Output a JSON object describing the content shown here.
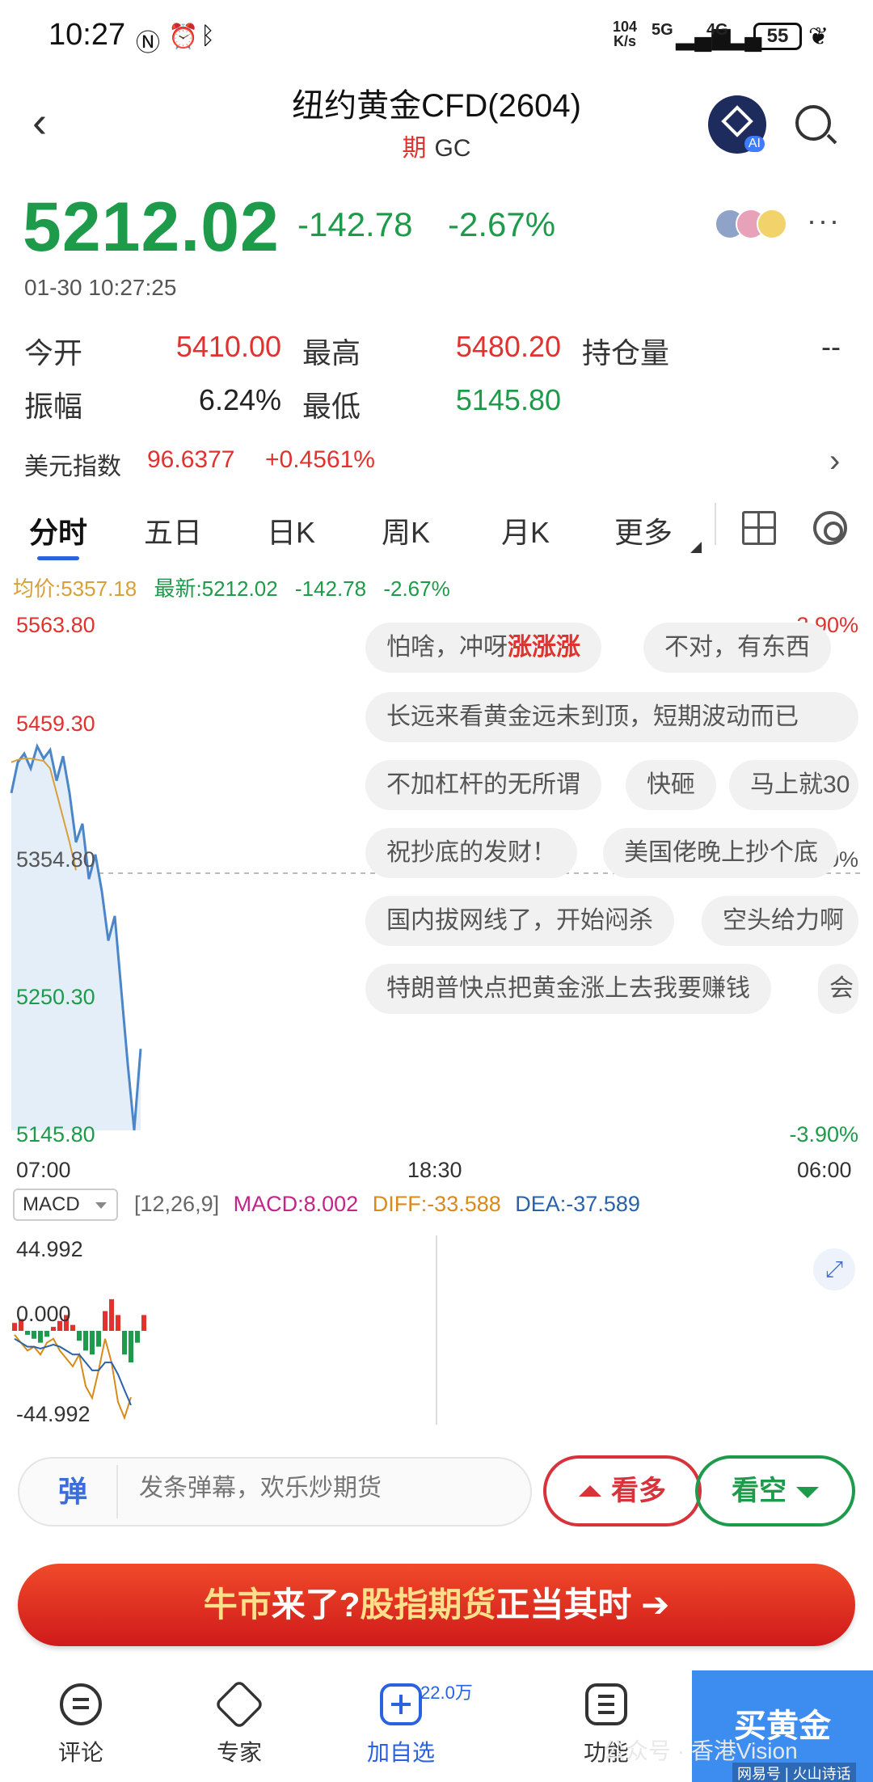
{
  "status_bar": {
    "time": "10:27",
    "net_speed": "104",
    "net_unit": "K/s",
    "sim1": "5G",
    "sim2": "4G",
    "battery": "55"
  },
  "header": {
    "title": "纽约黄金CFD(2604)",
    "tag": "期",
    "code": "GC"
  },
  "quote": {
    "price": "5212.02",
    "change": "-142.78",
    "change_pct": "-2.67%",
    "timestamp": "01-30 10:27:25"
  },
  "stats": {
    "open_label": "今开",
    "open": "5410.00",
    "high_label": "最高",
    "high": "5480.20",
    "oi_label": "持仓量",
    "oi": "--",
    "amp_label": "振幅",
    "amp": "6.24%",
    "low_label": "最低",
    "low": "5145.80"
  },
  "usd_index": {
    "label": "美元指数",
    "value": "96.6377",
    "change": "+0.4561%"
  },
  "tabs": [
    "分时",
    "五日",
    "日K",
    "周K",
    "月K",
    "更多"
  ],
  "legend": {
    "avg": "均价:5357.18",
    "latest": "最新:5212.02",
    "change": "-142.78",
    "pct": "-2.67%"
  },
  "danmaku": [
    {
      "text": "怕啥，冲呀",
      "hl": "涨涨涨"
    },
    {
      "text": "不对，有东西"
    },
    {
      "text": "长远来看黄金远未到顶，短期波动而已"
    },
    {
      "text": "不加杠杆的无所谓"
    },
    {
      "text": "快砸"
    },
    {
      "text": "马上就30"
    },
    {
      "text": "祝抄底的发财！"
    },
    {
      "text": "美国佬晚上抄个底"
    },
    {
      "text": "国内拔网线了，开始闷杀"
    },
    {
      "text": "空头给力啊"
    },
    {
      "text": "特朗普快点把黄金涨上去我要赚钱"
    },
    {
      "text": "会"
    }
  ],
  "chart_data": [
    {
      "type": "line",
      "y_ticks_left": [
        "5563.80",
        "5459.30",
        "5354.80",
        "5250.30",
        "5145.80"
      ],
      "y_ticks_right": [
        "3.90%",
        "0.00%",
        "-3.90%"
      ],
      "x_ticks": [
        "07:00",
        "18:30",
        "06:00"
      ],
      "ylim": [
        5145.8,
        5563.8
      ],
      "series": [
        {
          "values": [
            5420,
            5445,
            5452,
            5440,
            5458,
            5448,
            5455,
            5430,
            5450,
            5420,
            5380,
            5395,
            5350,
            5370,
            5340,
            5300,
            5320,
            5260,
            5200,
            5145.8,
            5212.02
          ],
          "color": "#4a86c8"
        },
        {
          "values": [
            5445,
            5447,
            5448,
            5448,
            5447,
            5446,
            5440,
            5420,
            5400,
            5380,
            5357.18
          ],
          "color": "#d8a03a"
        }
      ]
    },
    {
      "type": "bar",
      "title": "MACD",
      "params": "[12,26,9]",
      "macd": "MACD:8.002",
      "diff": "DIFF:-33.588",
      "dea": "DEA:-37.589",
      "y_ticks": [
        "44.992",
        "0.000",
        "-44.992"
      ],
      "ylim": [
        -44.992,
        44.992
      ],
      "values": [
        4,
        6,
        -2,
        -4,
        -6,
        -3,
        2,
        5,
        8,
        3,
        -5,
        -10,
        -12,
        -8,
        10,
        16,
        8,
        -12,
        -16,
        -6,
        8
      ],
      "diff_line": [
        -2,
        -6,
        -10,
        -8,
        -12,
        -6,
        -4,
        -10,
        -14,
        -18,
        -12,
        -28,
        -34,
        -20,
        -4,
        -16,
        -36,
        -44,
        -33.588
      ],
      "dea_line": [
        -4,
        -6,
        -8,
        -8,
        -9,
        -8,
        -7,
        -8,
        -10,
        -12,
        -12,
        -16,
        -20,
        -20,
        -16,
        -16,
        -22,
        -30,
        -37.589
      ]
    }
  ],
  "bottom": {
    "danmaku_icon": "弹",
    "danmaku_placeholder": "发条弹幕，欢乐炒期货",
    "long": "看多",
    "short": "看空",
    "banner_a": "牛市",
    "banner_b": "来了?",
    "banner_c": "股指期货",
    "banner_d": "正当其时 ➔"
  },
  "nav": {
    "comment": "评论",
    "expert": "专家",
    "watch": "加自选",
    "watch_count": "22.0万",
    "func": "功能",
    "buy": "买黄金",
    "watermark": "公众号 · 香港Vision",
    "watermark_sub": "网易号 | 火山诗话"
  },
  "colors": {
    "up": "#e0322f",
    "down": "#1e9b4a",
    "price_line": "#4a86c8",
    "avg_line": "#d8a03a",
    "accent": "#2a62e0"
  }
}
